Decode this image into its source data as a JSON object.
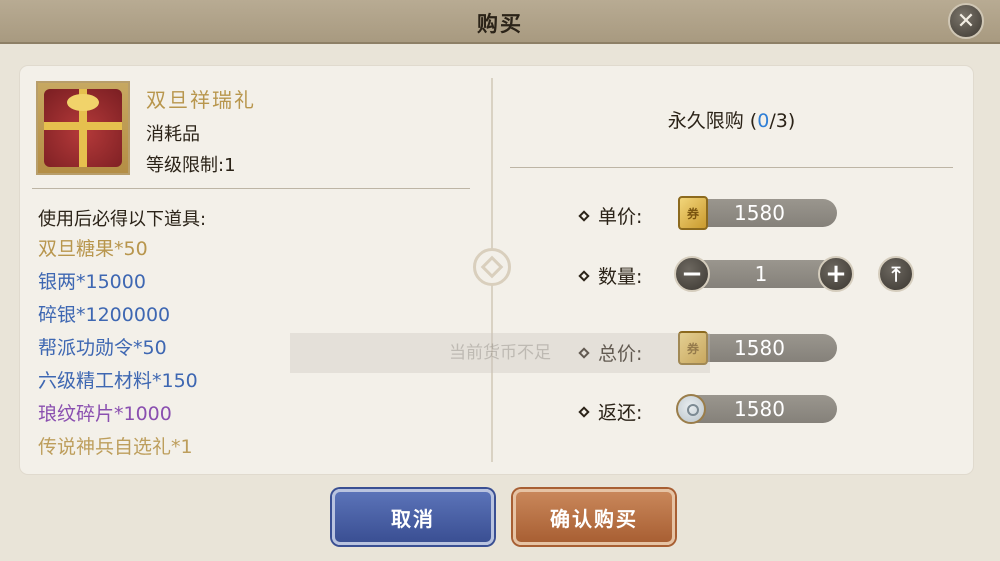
{
  "window": {
    "title": "购买"
  },
  "item": {
    "name": "双旦祥瑞礼",
    "type": "消耗品",
    "level_limit": "等级限制:1"
  },
  "contents": {
    "heading": "使用后必得以下道具:",
    "items": [
      {
        "text": "双旦糖果*50",
        "color": "#b8964d"
      },
      {
        "text": "银两*15000",
        "color": "#3e67b2"
      },
      {
        "text": "碎银*1200000",
        "color": "#3e67b2"
      },
      {
        "text": "帮派功勋令*50",
        "color": "#3e67b2"
      },
      {
        "text": "六级精工材料*150",
        "color": "#3e67b2"
      },
      {
        "text": "琅纹碎片*1000",
        "color": "#8a4fb0"
      },
      {
        "text": "传说神兵自选礼*1",
        "color": "#b8964d"
      }
    ]
  },
  "purchase": {
    "limit_prefix": "永久限购 (",
    "limit_bought": "0",
    "limit_sep": "/",
    "limit_max": "3",
    "limit_suffix": ")",
    "unit_price_label": "单价:",
    "unit_price": "1580",
    "quantity_label": "数量:",
    "quantity": "1",
    "total_label": "总价:",
    "total_price": "1580",
    "refund_label": "返还:",
    "refund": "1580"
  },
  "icons": {
    "close": "close-icon",
    "minus": "minus-icon",
    "plus": "plus-icon",
    "max": "max-icon",
    "currency": "gold-ticket-icon",
    "refund_currency": "silver-coin-icon"
  },
  "buttons": {
    "cancel": "取消",
    "confirm": "确认购买"
  },
  "toast": {
    "text": "当前货币不足"
  },
  "colors": {
    "accent_blue": "#2f7fd6",
    "cancel_button": "#3a4f93",
    "confirm_button": "#a85f33"
  }
}
